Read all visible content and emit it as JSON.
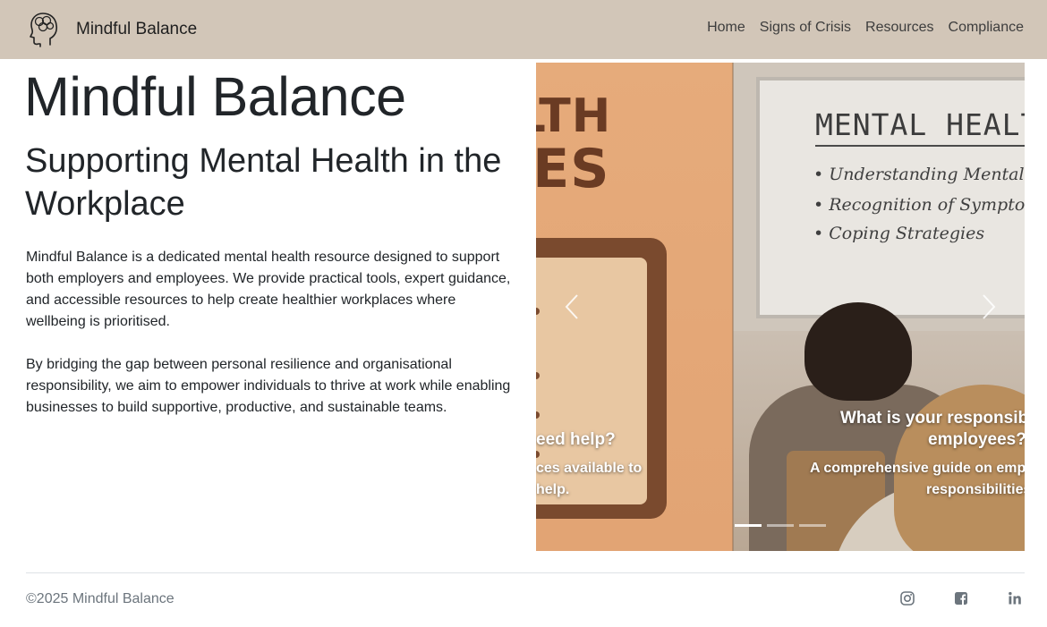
{
  "brand": {
    "name": "Mindful Balance",
    "logo_icon": "head-brain-icon"
  },
  "nav": {
    "items": [
      {
        "label": "Home"
      },
      {
        "label": "Signs of Crisis"
      },
      {
        "label": "Resources"
      },
      {
        "label": "Compliance"
      }
    ]
  },
  "hero": {
    "title": "Mindful Balance",
    "subtitle": "Supporting Mental Health in the Workplace",
    "paragraph1": "Mindful Balance is a dedicated mental health resource designed to support both employers and employees. We provide practical tools, expert guidance, and accessible resources to help create healthier workplaces where wellbeing is prioritised.",
    "paragraph2": "By bridging the gap between personal resilience and organisational responsibility, we aim to empower individuals to thrive at work while enabling businesses to build supportive, productive, and sustainable teams."
  },
  "carousel": {
    "slide_prev": {
      "image_text_line1": "EALTH",
      "image_text_line2": "RCES",
      "caption_title": "eed help?",
      "caption_line1": "ces available to",
      "caption_line2": "help."
    },
    "slide_current": {
      "whiteboard_title": "MENTAL HEALTH",
      "whiteboard_items": [
        "• Understanding Mental Health",
        "• Recognition of Symptoms",
        "• Coping Strategies"
      ],
      "caption_title_line1": "What is your responsib",
      "caption_title_line2": "employees?",
      "caption_line1": "A comprehensive guide on emplo",
      "caption_line2": "responsibilities"
    },
    "indicator_count": 3,
    "active_indicator": 1,
    "prev_icon": "chevron-left-icon",
    "next_icon": "chevron-right-icon"
  },
  "footer": {
    "copyright": "©2025 Mindful Balance",
    "social": [
      {
        "icon": "instagram-icon"
      },
      {
        "icon": "facebook-icon"
      },
      {
        "icon": "linkedin-icon"
      }
    ]
  },
  "colors": {
    "navbar_bg": "#d2c6b8",
    "text": "#212529",
    "muted": "#6c757d",
    "slide_orange": "#e4a776",
    "slide_brown": "#6a3b23"
  }
}
